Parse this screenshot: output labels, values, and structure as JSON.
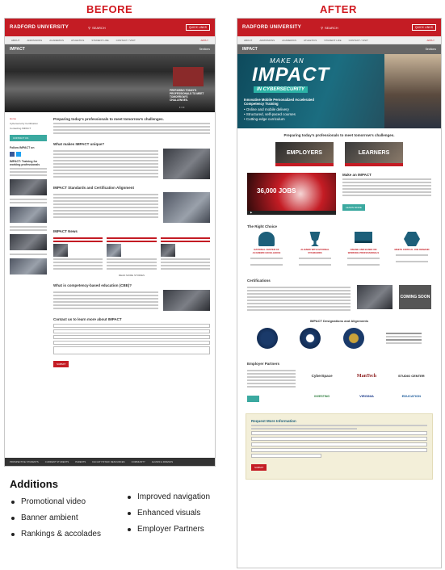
{
  "labels": {
    "before": "BEFORE",
    "after": "AFTER"
  },
  "site": {
    "brand": "RADFORD UNIVERSITY",
    "search": "SEARCH",
    "quick_links": "QUICK LINKS",
    "nav": [
      "ABOUT",
      "ADMISSIONS",
      "ACADEMICS",
      "ATHLETICS",
      "STUDENT LIFE",
      "CONTACT / VISIT"
    ],
    "apply": "APPLY",
    "page_title": "IMPACT",
    "section_menu": "Sections"
  },
  "before": {
    "sidebar": [
      "Home",
      "Cybersecurity Certification",
      "Contacting IMPACT"
    ],
    "contact_btn": "CONTACT US",
    "follow": "Follow IMPACT on",
    "training_heading": "IMPACT: Training for working professionals",
    "intro_heading": "Preparing today's professionals to meet tomorrow's challenges.",
    "hero_caption": "PREPARING TODAY'S PROFESSIONALS TO MEET TOMORROW'S CHALLENGES.",
    "s1": "What makes IMPACT unique?",
    "s2": "IMPACT Standards and Certification Alignment",
    "s3": "IMPACT News",
    "s4": "What is competency-based education (CBE)?",
    "s5": "Contact us to learn more about IMPACT",
    "submit": "SUBMIT",
    "news_link": "READ MORE STORIES",
    "footer": [
      "PROSPECTIVE STUDENTS",
      "CURRENT STUDENTS",
      "PARENTS",
      "FACULTY/STAFF RESOURCES",
      "COMMUNITY",
      "ALUMNI & FRIENDS"
    ]
  },
  "after": {
    "hero_line1": "MAKE AN",
    "hero_line2": "IMPACT",
    "hero_line3": "IN CYBERSECURITY",
    "hero_sub": "Innovative Mobile Personalized Accelerated Competency Training",
    "hero_bullets": [
      "Online and mobile delivery",
      "Structured, self-paced courses",
      "Cutting-edge curriculum"
    ],
    "tagline": "Preparing today's professionals to meet tomorrow's challenges.",
    "tiles": [
      "EMPLOYERS",
      "LEARNERS"
    ],
    "video_text": "36,000 JOBS",
    "make_impact": "Make an IMPACT",
    "learn_more": "LEARN MORE",
    "right_choice": "The Right Choice",
    "accolades": [
      "NATIONAL CENTER OF ACADEMIC EXCELLENCE",
      "ALIGNED WITH NATIONAL STANDARDS",
      "ONLINE AND BASED ON WORKING PROFESSIONALS",
      "MEETS CRITICAL JOB DEMAND"
    ],
    "certifications": "Certifications",
    "coming_soon": "COMING SOON",
    "designations": "IMPACT Designations and Alignments",
    "employer_partners": "Employer Partners",
    "partners": [
      "CyberSpace",
      "ManTech",
      "STUDIO CENTER",
      "INVESTING",
      "VIRGINIA",
      "EDUCATION"
    ],
    "request": "Request More Information",
    "submit": "SUBMIT"
  },
  "additions": {
    "title": "Additions",
    "col1": [
      "Promotional video",
      "Banner ambient",
      "Rankings & accolades"
    ],
    "col2": [
      "Improved navigation",
      "Enhanced visuals",
      "Employer Partners"
    ]
  }
}
